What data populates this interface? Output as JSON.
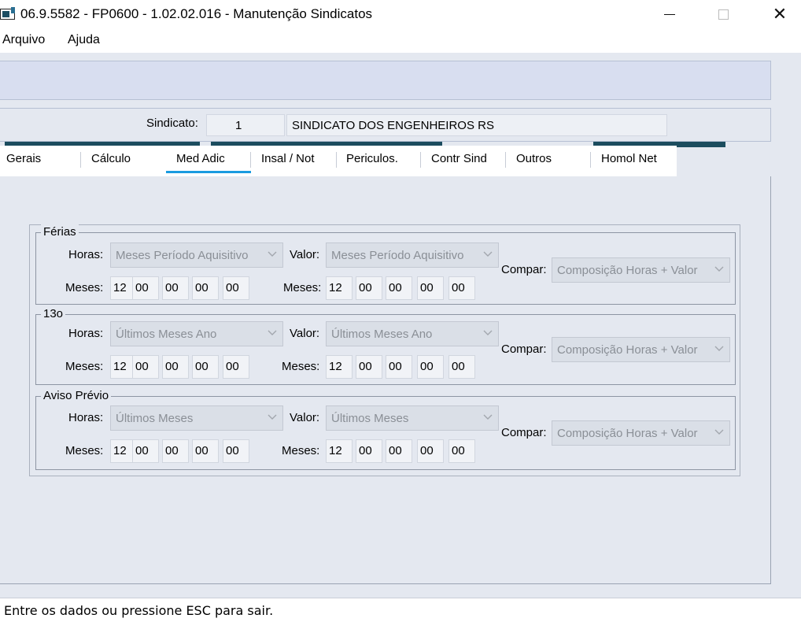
{
  "window": {
    "title": "06.9.5582 - FP0600 - 1.02.02.016 - Manutenção Sindicatos"
  },
  "menu": {
    "items": [
      "Arquivo",
      "Ajuda"
    ]
  },
  "toolbar": {
    "nav": [
      "first-icon",
      "previous-icon",
      "next-icon",
      "last-icon",
      "return-icon",
      "search-icon"
    ],
    "edit": [
      "new-document-icon",
      "copy-icon",
      "edit-icon",
      "delete-icon",
      "undo-icon",
      "cancel-icon",
      "confirm-icon"
    ],
    "extra": [
      "structure-icon",
      "print-icon",
      "exit-icon",
      "help-icon"
    ],
    "color": "#1b4c5e"
  },
  "sindicato": {
    "label": "Sindicato:",
    "code": "1",
    "name": "SINDICATO DOS ENGENHEIROS RS"
  },
  "tabs": [
    {
      "label": "Gerais"
    },
    {
      "label": "Cálculo"
    },
    {
      "label": "Med Adic"
    },
    {
      "label": "Insal / Not"
    },
    {
      "label": "Periculos."
    },
    {
      "label": "Contr Sind"
    },
    {
      "label": "Outros"
    },
    {
      "label": "Homol Net"
    }
  ],
  "active_tab": "Med Adic",
  "labels": {
    "horas": "Horas:",
    "valor": "Valor:",
    "compar": "Compar:",
    "meses": "Meses:"
  },
  "groups": [
    {
      "title": "Férias",
      "horas": "Meses Período Aquisitivo",
      "valor": "Meses Período Aquisitivo",
      "compar": "Composição Horas + Valor",
      "meses_horas": [
        "12",
        "00",
        "00",
        "00",
        "00"
      ],
      "meses_valor": [
        "12",
        "00",
        "00",
        "00",
        "00"
      ]
    },
    {
      "title": "13o",
      "horas": "Últimos Meses Ano",
      "valor": "Últimos Meses Ano",
      "compar": "Composição Horas + Valor",
      "meses_horas": [
        "12",
        "00",
        "00",
        "00",
        "00"
      ],
      "meses_valor": [
        "12",
        "00",
        "00",
        "00",
        "00"
      ]
    },
    {
      "title": "Aviso Prévio",
      "horas": "Últimos Meses",
      "valor": "Últimos Meses",
      "compar": "Composição Horas + Valor",
      "meses_horas": [
        "12",
        "00",
        "00",
        "00",
        "00"
      ],
      "meses_valor": [
        "12",
        "00",
        "00",
        "00",
        "00"
      ]
    }
  ],
  "status": {
    "text": "Entre os dados ou pressione ESC para sair."
  }
}
